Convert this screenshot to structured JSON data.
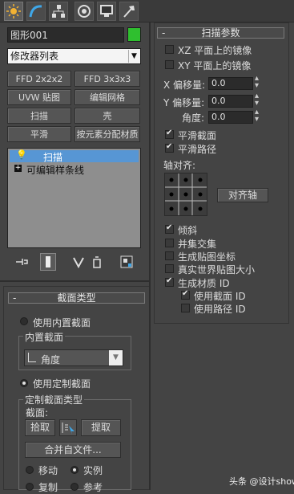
{
  "tabs": [
    {
      "icon": "create-sun-icon"
    },
    {
      "icon": "modify-curve-icon"
    },
    {
      "icon": "hierarchy-icon"
    },
    {
      "icon": "motion-icon"
    },
    {
      "icon": "display-monitor-icon"
    },
    {
      "icon": "utilities-hammer-icon"
    }
  ],
  "object_name": "图形001",
  "object_color": "#2fbf2f",
  "modifier_list": "修改器列表",
  "buttons": [
    "FFD 2x2x2",
    "FFD 3x3x3",
    "UVW 贴图",
    "编辑网格",
    "扫描",
    "壳",
    "平滑",
    "按元素分配材质"
  ],
  "stack": {
    "items": [
      {
        "label": "扫描",
        "selected": true
      },
      {
        "label": "可编辑样条线",
        "selected": false
      }
    ]
  },
  "section_type": {
    "title": "截面类型",
    "use_builtin_label": "使用内置截面",
    "builtin_group_title": "内置截面",
    "builtin_value": "角度",
    "use_custom_label": "使用定制截面",
    "custom_group_title": "定制截面类型",
    "section_label": "截面:",
    "pick_label": "拾取",
    "extract_label": "提取",
    "merge_label": "合并自文件...",
    "move_label": "移动",
    "instance_label": "实例",
    "copy_label": "复制",
    "reference_label": "参考"
  },
  "sweep_params": {
    "title": "扫描参数",
    "xz_mirror": "XZ 平面上的镜像",
    "xy_mirror": "XY 平面上的镜像",
    "x_offset_label": "X 偏移量:",
    "x_offset_value": "0.0",
    "y_offset_label": "Y 偏移量:",
    "y_offset_value": "0.0",
    "angle_label": "角度:",
    "angle_value": "0.0",
    "smooth_section": "平滑截面",
    "smooth_path": "平滑路径",
    "pivot_align_label": "轴对齐:",
    "align_pivot_button": "对齐轴",
    "banking": "倾斜",
    "union_intersect": "并集交集",
    "gen_mapping": "生成贴图坐标",
    "real_world": "真实世界贴图大小",
    "gen_material_ids": "生成材质 ID",
    "use_section_ids": "使用截面 ID",
    "use_path_ids": "使用路径 ID"
  },
  "watermark": "头条 @设计show"
}
